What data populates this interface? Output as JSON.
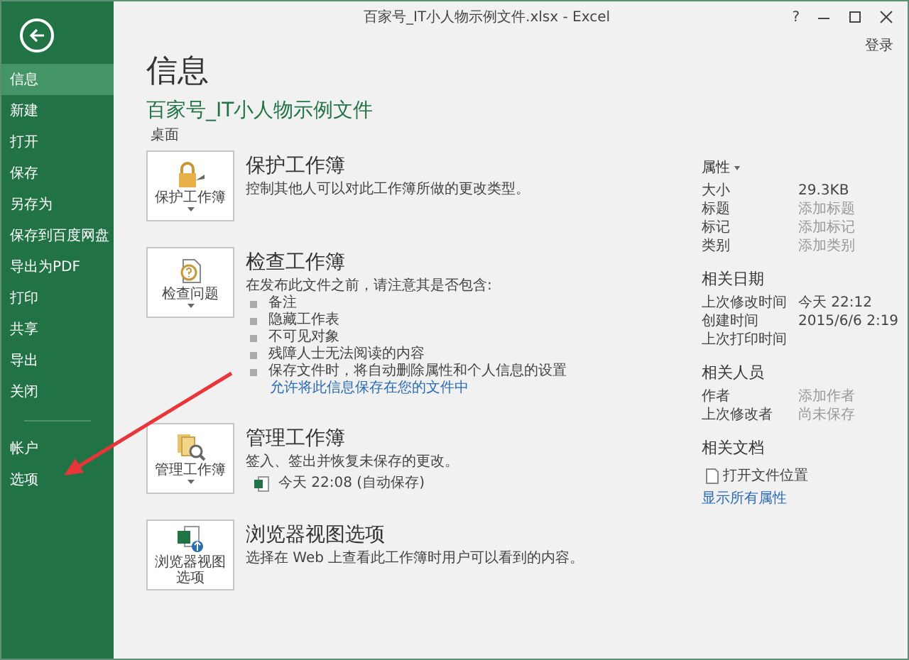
{
  "window": {
    "title": "百家号_IT小人物示例文件.xlsx - Excel",
    "help": "?",
    "sign_in": "登录"
  },
  "sidebar": {
    "items": [
      {
        "label": "信息",
        "selected": true
      },
      {
        "label": "新建",
        "selected": false
      },
      {
        "label": "打开",
        "selected": false
      },
      {
        "label": "保存",
        "selected": false
      },
      {
        "label": "另存为",
        "selected": false
      },
      {
        "label": "保存到百度网盘",
        "selected": false
      },
      {
        "label": "导出为PDF",
        "selected": false
      },
      {
        "label": "打印",
        "selected": false
      },
      {
        "label": "共享",
        "selected": false
      },
      {
        "label": "导出",
        "selected": false
      },
      {
        "label": "关闭",
        "selected": false
      }
    ],
    "bottom_items": [
      {
        "label": "帐户",
        "selected": false
      },
      {
        "label": "选项",
        "selected": false
      }
    ]
  },
  "page_title": "信息",
  "file": {
    "name": "百家号_IT小人物示例文件",
    "location": "桌面"
  },
  "sections": [
    {
      "kind": "protect",
      "button_label": "保护工作簿",
      "dropdown": true,
      "title": "保护工作簿",
      "description": "控制其他人可以对此工作簿所做的更改类型。"
    },
    {
      "kind": "inspect",
      "button_label": "检查问题",
      "dropdown": true,
      "title": "检查工作簿",
      "description": "在发布此文件之前，请注意其是否包含:",
      "checklist": [
        "备注",
        "隐藏工作表",
        "不可见对象",
        "残障人士无法阅读的内容",
        "保存文件时，将自动删除属性和个人信息的设置"
      ],
      "link": "允许将此信息保存在您的文件中"
    },
    {
      "kind": "manage",
      "button_label": "管理工作簿",
      "dropdown": true,
      "title": "管理工作簿",
      "description": "签入、签出并恢复未保存的更改。",
      "versions": [
        "今天 22:08 (自动保存)"
      ]
    },
    {
      "kind": "browser",
      "button_label": "浏览器视图选项",
      "dropdown": false,
      "title": "浏览器视图选项",
      "description": "选择在 Web 上查看此工作簿时用户可以看到的内容。"
    }
  ],
  "properties": {
    "title": "属性",
    "rows": [
      {
        "label": "大小",
        "value": "29.3KB",
        "muted": false
      },
      {
        "label": "标题",
        "value": "添加标题",
        "muted": true
      },
      {
        "label": "标记",
        "value": "添加标记",
        "muted": true
      },
      {
        "label": "类别",
        "value": "添加类别",
        "muted": true
      }
    ]
  },
  "related_dates": {
    "title": "相关日期",
    "rows": [
      {
        "label": "上次修改时间",
        "value": "今天 22:12"
      },
      {
        "label": "创建时间",
        "value": "2015/6/6 2:19"
      },
      {
        "label": "上次打印时间"
      }
    ]
  },
  "related_people": {
    "title": "相关人员",
    "rows": [
      {
        "label": "作者",
        "value": "添加作者",
        "muted": true
      },
      {
        "label": "上次修改者",
        "value": "尚未保存",
        "muted": true
      }
    ]
  },
  "related_documents": {
    "title": "相关文档",
    "items": [
      "打开文件位置"
    ],
    "link": "显示所有属性"
  }
}
